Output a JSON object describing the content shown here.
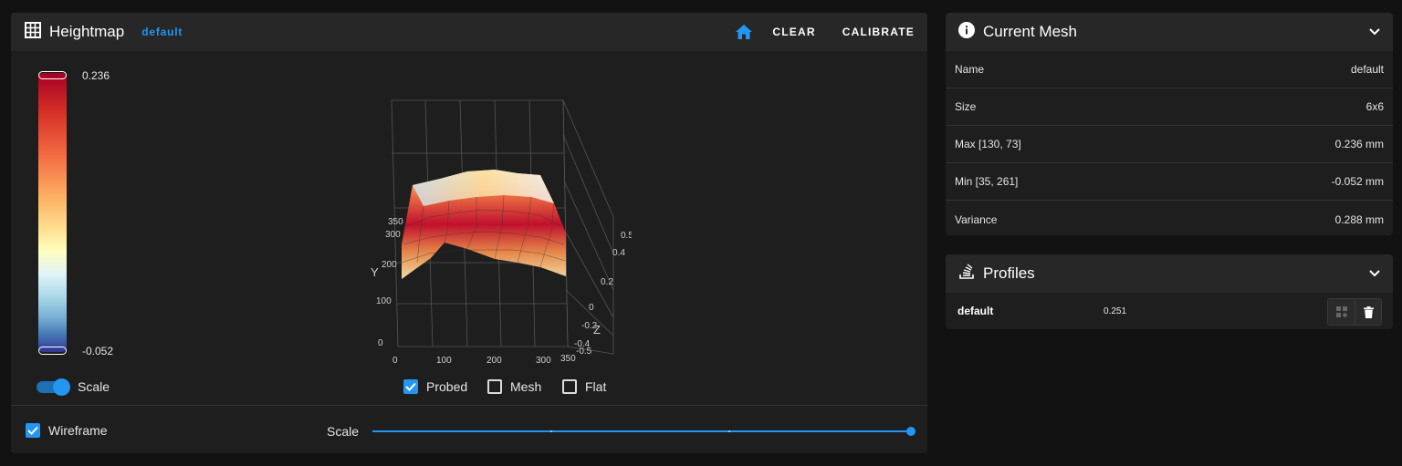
{
  "heightmap": {
    "title": "Heightmap",
    "profile": "default",
    "home_icon": "home-icon",
    "clear_label": "CLEAR",
    "calibrate_label": "CALIBRATE",
    "legend": {
      "max": "0.236",
      "min": "-0.052"
    },
    "scale_switch_label": "Scale",
    "scale_switch_on": true,
    "options": [
      {
        "label": "Probed",
        "checked": true
      },
      {
        "label": "Mesh",
        "checked": false
      },
      {
        "label": "Flat",
        "checked": false
      }
    ],
    "wireframe_label": "Wireframe",
    "wireframe_checked": true,
    "scale_slider_label": "Scale",
    "scale_slider_value": 1.0,
    "plot": {
      "x_ticks": [
        "0",
        "100",
        "200",
        "300",
        "350"
      ],
      "y_ticks": [
        "0",
        "100",
        "200",
        "300",
        "350"
      ],
      "z_ticks": [
        "0.5",
        "0.4",
        "0.2",
        "0",
        "-0.2",
        "-0.4",
        "-0.5"
      ],
      "y_axis": "Y",
      "z_axis": "Z"
    }
  },
  "current_mesh": {
    "title": "Current Mesh",
    "rows": [
      {
        "label": "Name",
        "value": "default"
      },
      {
        "label": "Size",
        "value": "6x6"
      },
      {
        "label": "Max [130, 73]",
        "value": "0.236 mm"
      },
      {
        "label": "Min [35, 261]",
        "value": "-0.052 mm"
      },
      {
        "label": "Variance",
        "value": "0.288 mm"
      }
    ]
  },
  "profiles": {
    "title": "Profiles",
    "items": [
      {
        "name": "default",
        "variance": "0.251"
      }
    ]
  },
  "colors": {
    "accent": "#2196f3",
    "card": "#1e1e1e",
    "header": "#272727",
    "background": "#121212"
  }
}
